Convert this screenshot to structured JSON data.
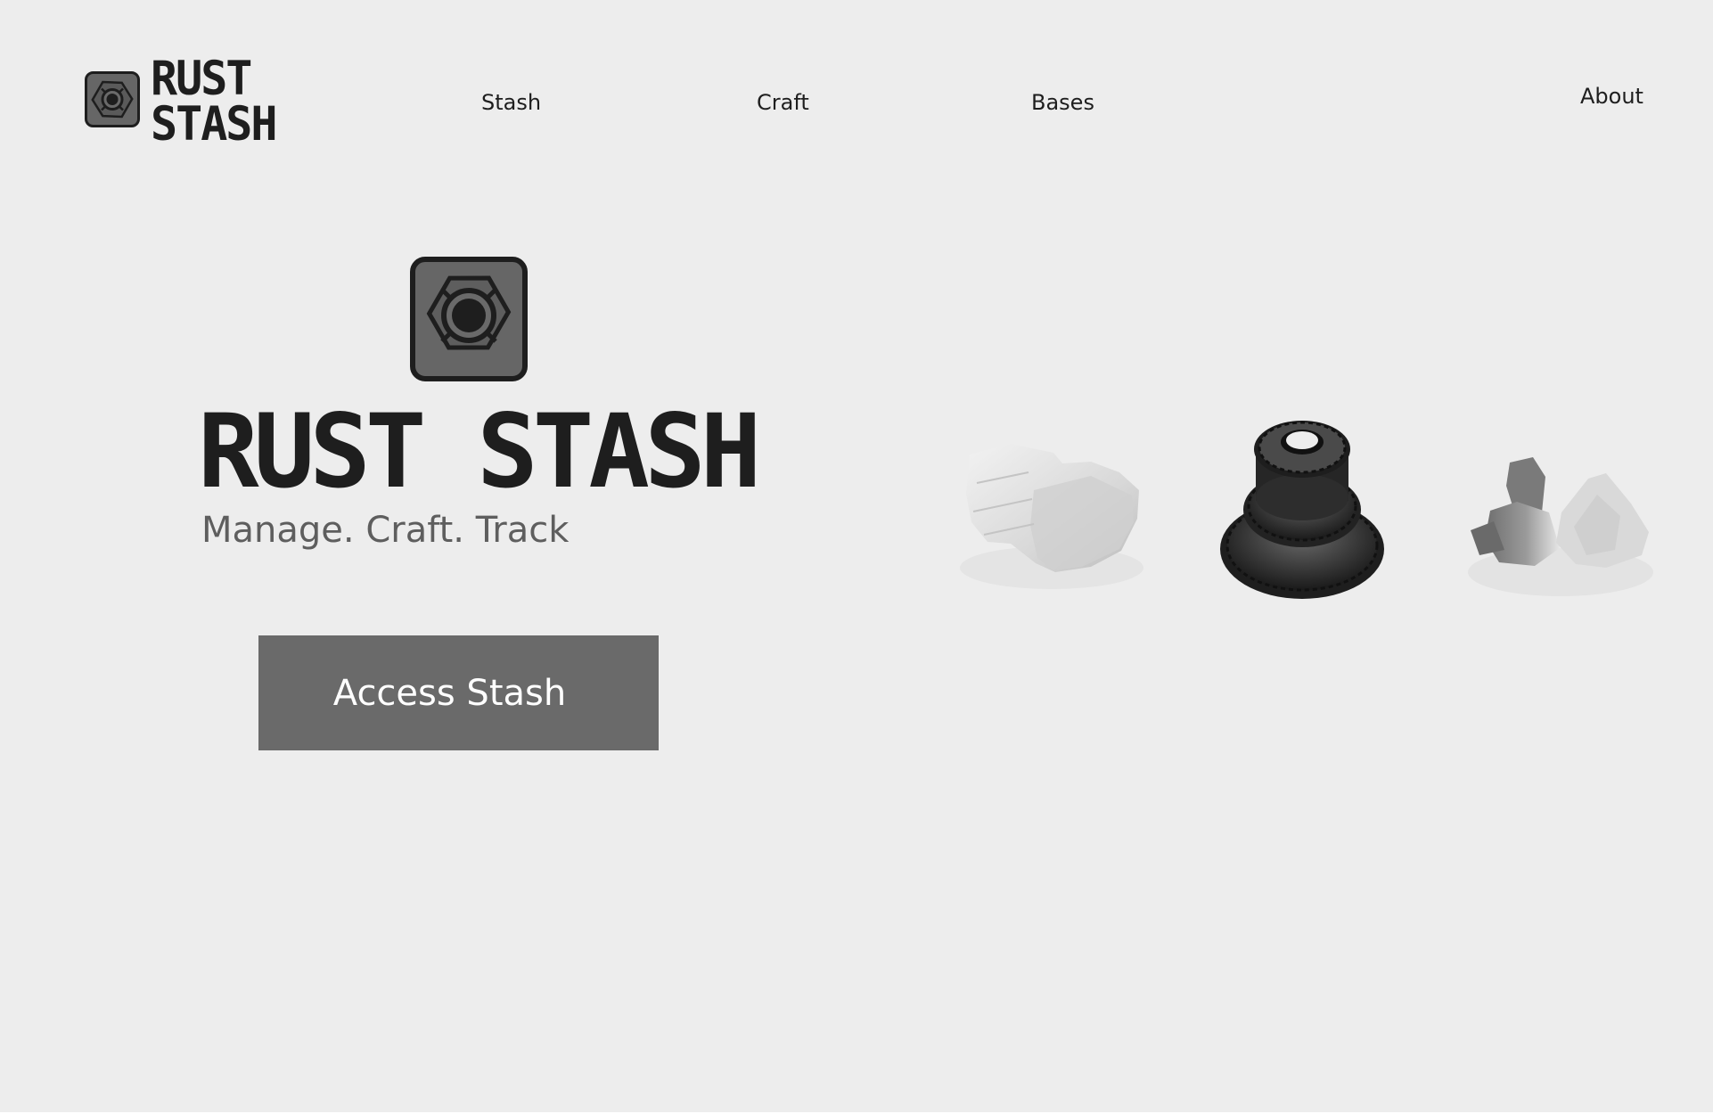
{
  "header": {
    "logo": {
      "line1": "RUST",
      "line2": "STASH"
    },
    "nav": {
      "stash": "Stash",
      "craft": "Craft",
      "bases": "Bases",
      "about": "About"
    }
  },
  "hero": {
    "title": "RUST STASH",
    "subtitle": "Manage. Craft. Track",
    "cta_label": "Access Stash"
  },
  "resources": [
    {
      "name": "stone",
      "icon": "stone-chunk-image"
    },
    {
      "name": "gears",
      "icon": "gear-stack-image"
    },
    {
      "name": "metal-fragments",
      "icon": "metal-fragments-image"
    }
  ],
  "colors": {
    "background": "#ededed",
    "text": "#1e1e1e",
    "subtitle": "#5e5e5e",
    "button": "#6a6a6a",
    "button_text": "#ffffff"
  }
}
